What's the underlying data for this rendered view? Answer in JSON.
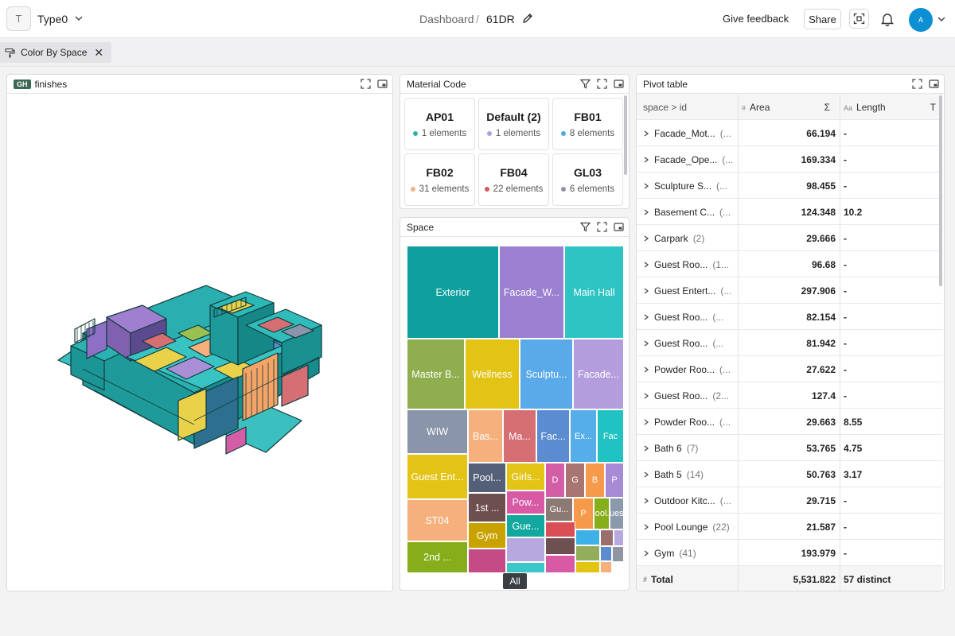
{
  "topbar": {
    "workspace_initial": "T",
    "workspace_name": "Type0",
    "breadcrumb_root": "Dashboard",
    "breadcrumb_separator": "/",
    "breadcrumb_current": "61DR",
    "feedback_label": "Give feedback",
    "share_label": "Share",
    "user_initial": "A",
    "user_avatar_color": "#0d8fd4"
  },
  "filters": {
    "active_filter": "Color By Space",
    "remove_symbol": "✕"
  },
  "finishes_panel": {
    "badge": "GH",
    "title": "finishes"
  },
  "material_panel": {
    "title": "Material Code",
    "cards": [
      {
        "name": "AP01",
        "count": "1 elements",
        "color": "#2bb5a8"
      },
      {
        "name": "Default (2)",
        "count": "1 elements",
        "color": "#b39ddb"
      },
      {
        "name": "FB01",
        "count": "8 elements",
        "color": "#4aa9e0"
      },
      {
        "name": "FB02",
        "count": "31 elements",
        "color": "#f4b183"
      },
      {
        "name": "FB04",
        "count": "22 elements",
        "color": "#d9595b"
      },
      {
        "name": "GL03",
        "count": "6 elements",
        "color": "#8a93a8"
      }
    ]
  },
  "space_panel": {
    "title": "Space",
    "all_label": "All",
    "cells": [
      {
        "label": "Exterior",
        "color": "#0d9e9e"
      },
      {
        "label": "Facade_W...",
        "color": "#9b7fd1"
      },
      {
        "label": "Main Hall",
        "color": "#2ec4c4"
      },
      {
        "label": "Master B...",
        "color": "#8fae4e"
      },
      {
        "label": "Wellness",
        "color": "#e3c313"
      },
      {
        "label": "Sculptu...",
        "color": "#5aa9e8"
      },
      {
        "label": "Facade...",
        "color": "#b49ddc"
      },
      {
        "label": "WIW",
        "color": "#8a95aa"
      },
      {
        "label": "Bas...",
        "color": "#f6b07c"
      },
      {
        "label": "Ma...",
        "color": "#d66f73"
      },
      {
        "label": "Fac...",
        "color": "#5b8bd1"
      },
      {
        "label": "Ex...",
        "color": "#55aeea"
      },
      {
        "label": "Fac",
        "color": "#20c2c2"
      },
      {
        "label": "Guest Ent...",
        "color": "#e3c313"
      },
      {
        "label": "Pool...",
        "color": "#546077"
      },
      {
        "label": "Girls...",
        "color": "#e3c313"
      },
      {
        "label": "D",
        "color": "#d45ea6"
      },
      {
        "label": "G",
        "color": "#a87572"
      },
      {
        "label": "B",
        "color": "#f49a4a"
      },
      {
        "label": "P",
        "color": "#a78ad6"
      },
      {
        "label": "ST04",
        "color": "#f6b07c"
      },
      {
        "label": "1st ...",
        "color": "#6e4f4f"
      },
      {
        "label": "Pow...",
        "color": "#d85aa4"
      },
      {
        "label": "Gu...",
        "color": "#8b7a73"
      },
      {
        "label": "P",
        "color": "#f49a4a"
      },
      {
        "label": "Pool...",
        "color": "#86ad1a"
      },
      {
        "label": "Gues...",
        "color": "#8b99ad"
      },
      {
        "label": "Gym",
        "color": "#c8a300"
      },
      {
        "label": "Gue...",
        "color": "#12a8a0"
      },
      {
        "label": "2nd ...",
        "color": "#86ad1a"
      },
      {
        "label": "",
        "color": "#c44b86"
      },
      {
        "label": "",
        "color": "#b7a8e0"
      },
      {
        "label": "",
        "color": "#3bc7c7"
      },
      {
        "label": "",
        "color": "#d94f55"
      },
      {
        "label": "",
        "color": "#3db0e8"
      },
      {
        "label": "",
        "color": "#9b6e6e"
      },
      {
        "label": "",
        "color": "#b7a8e0"
      },
      {
        "label": "",
        "color": "#6e5050"
      },
      {
        "label": "",
        "color": "#93ae5a"
      },
      {
        "label": "",
        "color": "#5b8bd1"
      },
      {
        "label": "",
        "color": "#8f95a3"
      },
      {
        "label": "",
        "color": "#d85aa4"
      },
      {
        "label": "",
        "color": "#e3c313"
      },
      {
        "label": "",
        "color": "#f6b07c"
      }
    ]
  },
  "pivot_panel": {
    "title": "Pivot table",
    "columns": {
      "group": "space > id",
      "area": "Area",
      "area_agg": "Σ",
      "length": "Length",
      "length_agg": "T"
    },
    "rows": [
      {
        "name": "Facade_Mot...",
        "count": "(...",
        "area": "66.194",
        "length": "-"
      },
      {
        "name": "Facade_Ope...",
        "count": "(...",
        "area": "169.334",
        "length": "-"
      },
      {
        "name": "Sculpture S...",
        "count": "(...",
        "area": "98.455",
        "length": "-"
      },
      {
        "name": "Basement C...",
        "count": "(...",
        "area": "124.348",
        "length": "10.2"
      },
      {
        "name": "Carpark",
        "count": "(2)",
        "area": "29.666",
        "length": "-"
      },
      {
        "name": "Guest Roo...",
        "count": "(1...",
        "area": "96.68",
        "length": "-"
      },
      {
        "name": "Guest Entert...",
        "count": "(...",
        "area": "297.906",
        "length": "-"
      },
      {
        "name": "Guest Roo...",
        "count": "(...",
        "area": "82.154",
        "length": "-"
      },
      {
        "name": "Guest Roo...",
        "count": "(...",
        "area": "81.942",
        "length": "-"
      },
      {
        "name": "Powder Roo...",
        "count": "(...",
        "area": "27.622",
        "length": "-"
      },
      {
        "name": "Guest Roo...",
        "count": "(2...",
        "area": "127.4",
        "length": "-"
      },
      {
        "name": "Powder Roo...",
        "count": "(...",
        "area": "29.663",
        "length": "8.55"
      },
      {
        "name": "Bath 6",
        "count": "(7)",
        "area": "53.765",
        "length": "4.75"
      },
      {
        "name": "Bath 5",
        "count": "(14)",
        "area": "50.763",
        "length": "3.17"
      },
      {
        "name": "Outdoor Kitc...",
        "count": "(...",
        "area": "29.715",
        "length": "-"
      },
      {
        "name": "Pool Lounge",
        "count": "(22)",
        "area": "21.587",
        "length": "-"
      },
      {
        "name": "Gym",
        "count": "(41)",
        "area": "193.979",
        "length": "-"
      }
    ],
    "total": {
      "label": "Total",
      "area": "5,531.822",
      "length": "57 distinct"
    }
  }
}
